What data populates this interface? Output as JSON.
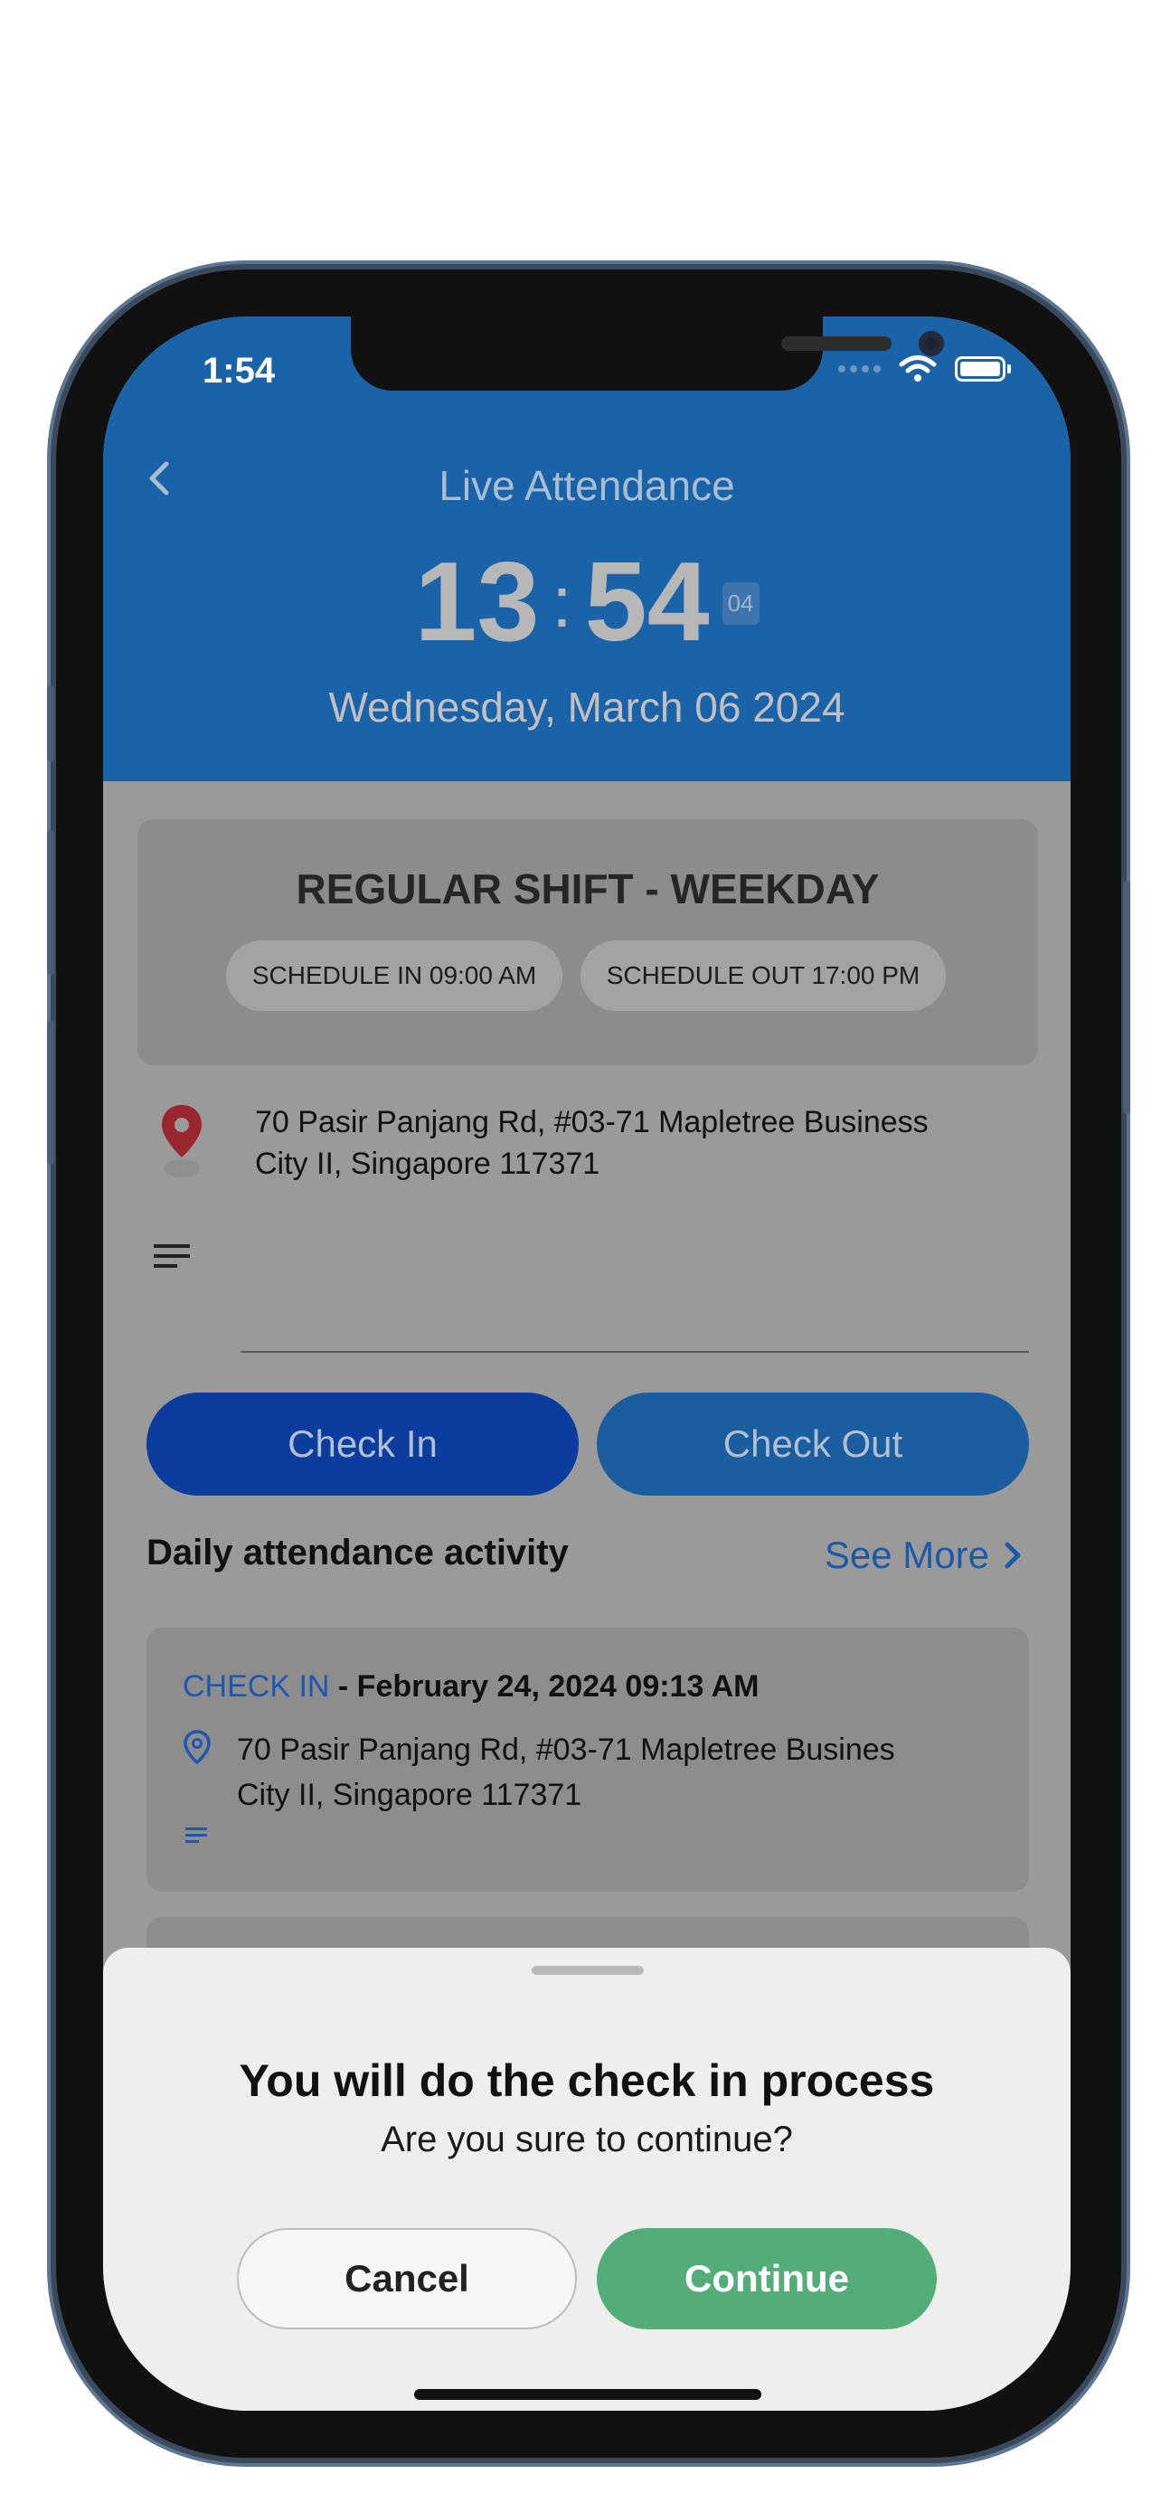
{
  "status_bar": {
    "time": "1:54"
  },
  "header": {
    "title": "Live Attendance",
    "clock": {
      "hours": "13",
      "minutes": "54",
      "seconds": "04"
    },
    "date": "Wednesday, March 06 2024",
    "background_color": "#1a63a9"
  },
  "shift": {
    "title": "REGULAR SHIFT - WEEKDAY",
    "schedule_in": "SCHEDULE IN 09:00 AM",
    "schedule_out": "SCHEDULE OUT 17:00 PM"
  },
  "location": {
    "address_line1": "70 Pasir Panjang Rd, #03-71 Mapletree Business",
    "address_line2": "City II, Singapore 117371"
  },
  "actions": {
    "check_in_label": "Check In",
    "check_out_label": "Check Out"
  },
  "activity": {
    "heading": "Daily attendance activity",
    "see_more_label": "See More",
    "items": [
      {
        "kind": "CHECK IN",
        "rest": " - February 24, 2024 09:13 AM",
        "address_line1": "70 Pasir Panjang Rd, #03-71 Mapletree Busines",
        "address_line2": "City II, Singapore 117371"
      }
    ]
  },
  "dialog": {
    "title": "You will do the check in process",
    "subtitle": "Are you sure to continue?",
    "cancel_label": "Cancel",
    "continue_label": "Continue",
    "continue_color": "#52ad79"
  },
  "icons": {
    "back": "chevron-left-icon",
    "location": "map-pin-icon",
    "notes": "notes-lines-icon",
    "see_more": "chevron-right-icon",
    "wifi": "wifi-icon",
    "battery": "battery-icon"
  }
}
